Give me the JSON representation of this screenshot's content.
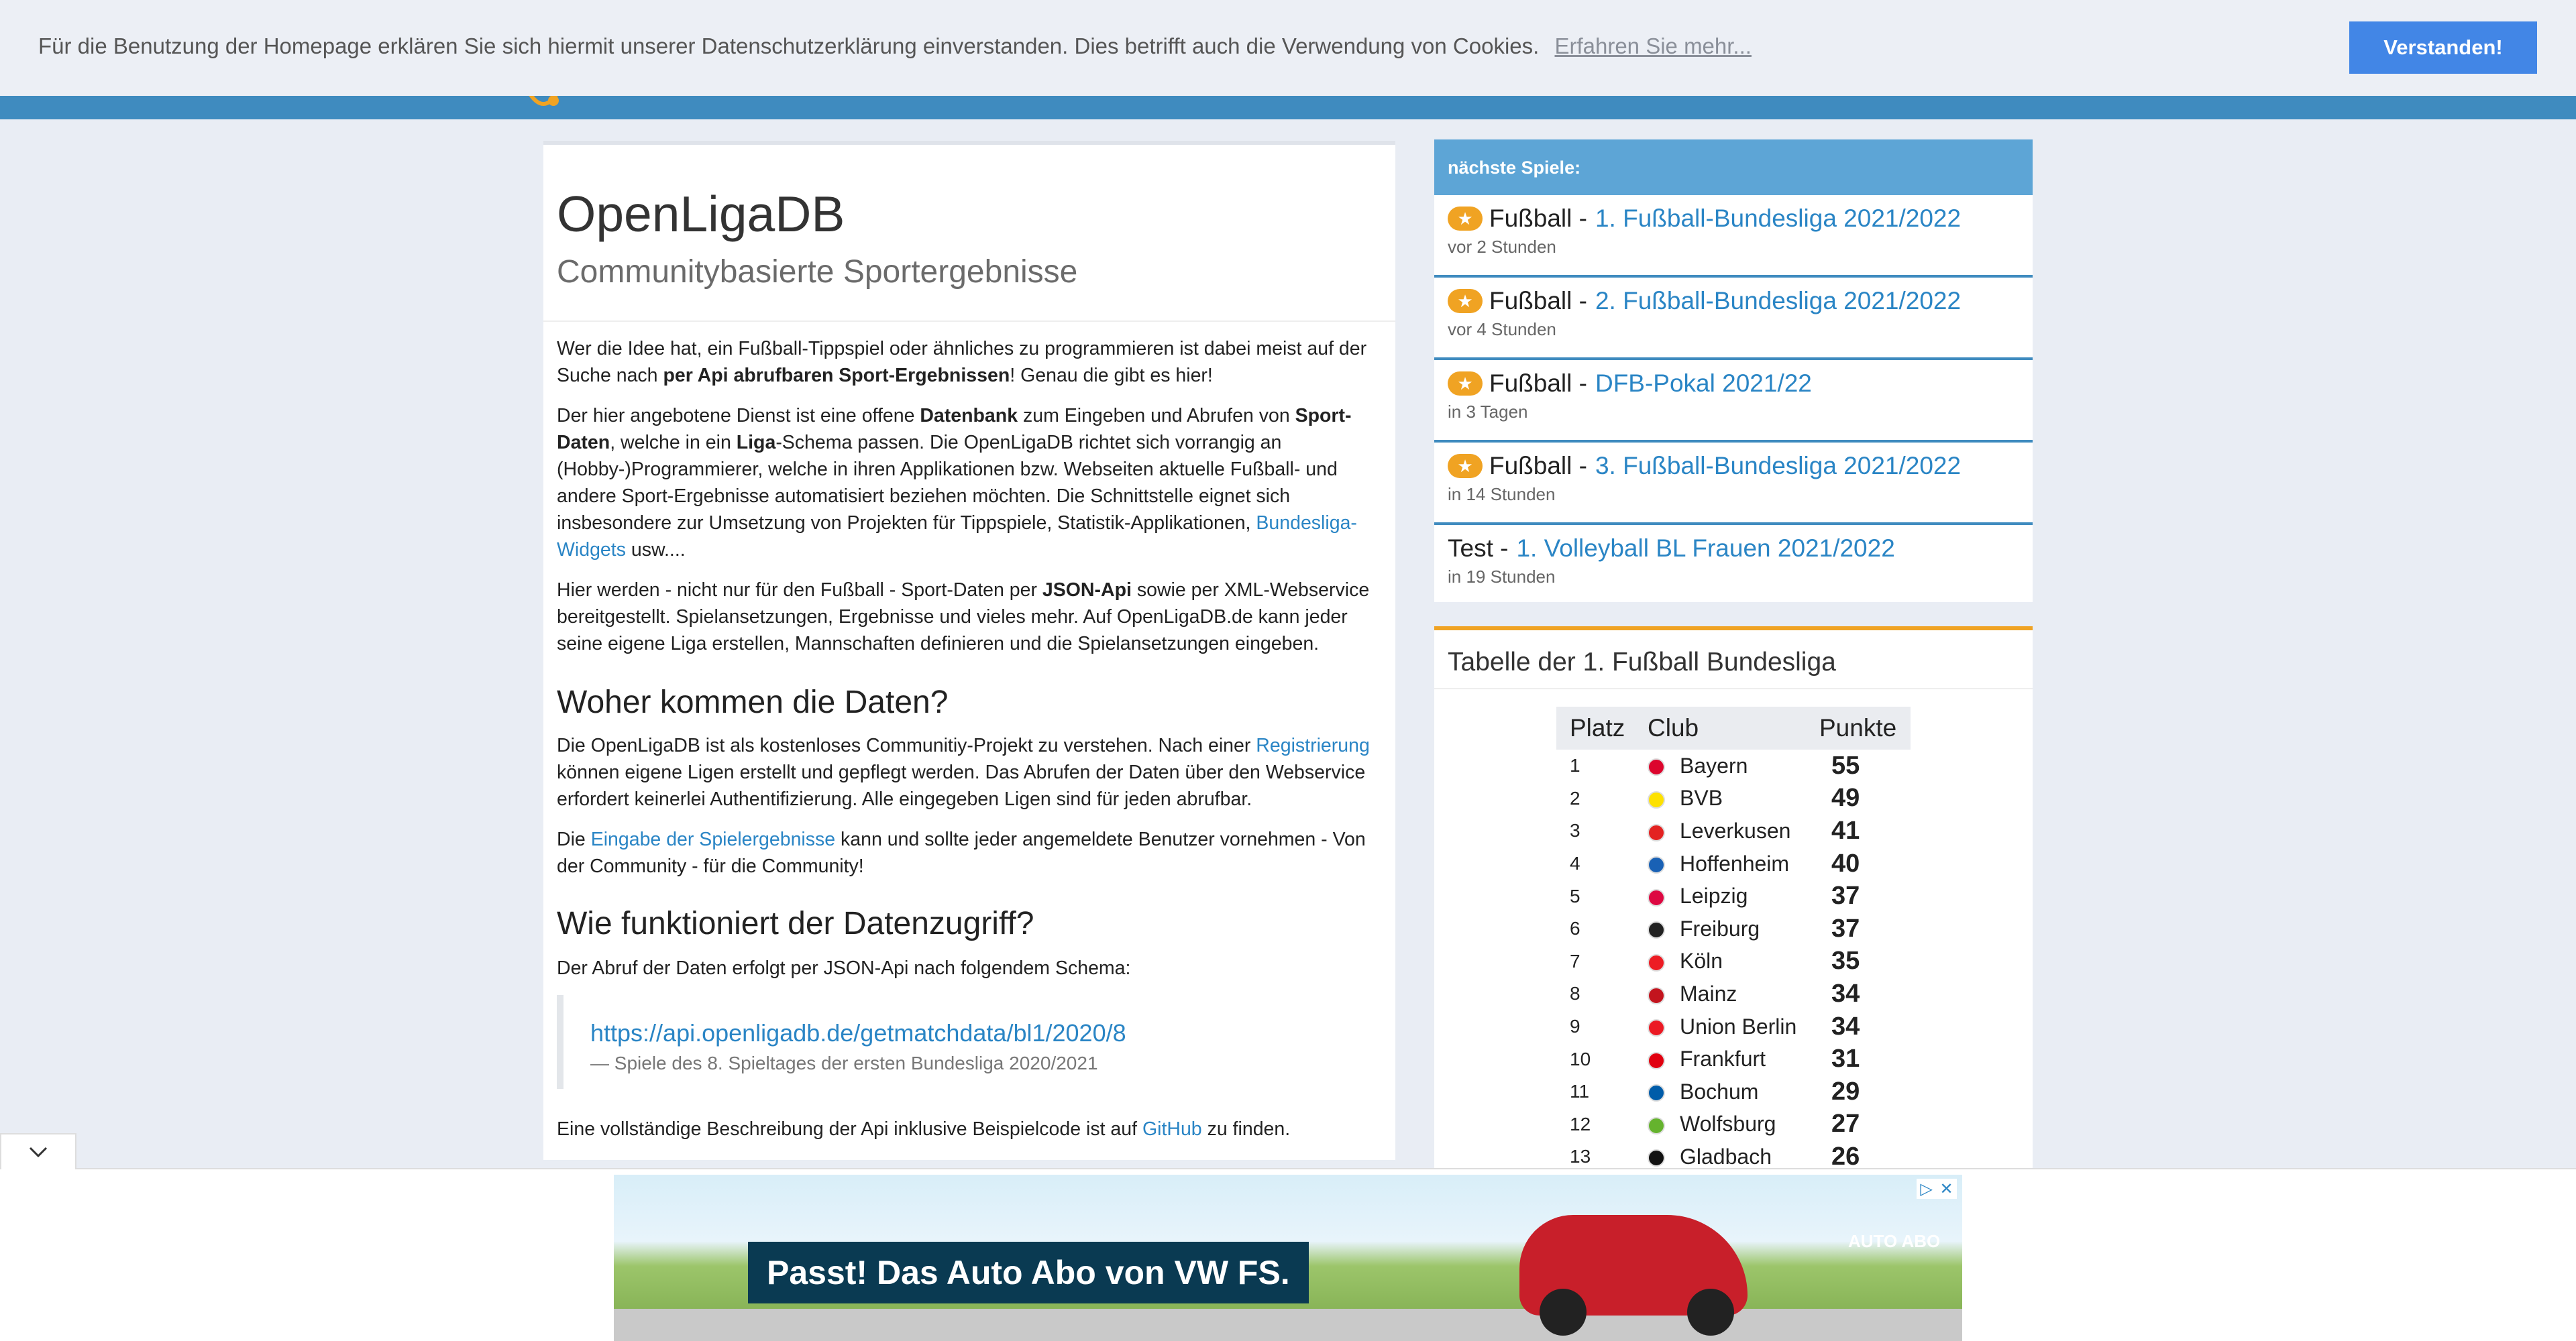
{
  "cookie": {
    "text": "Für die Benutzung der Homepage erklären Sie sich hiermit unserer Datenschutzerklärung einverstanden. Dies betrifft auch die Verwendung von Cookies.",
    "link": "Erfahren Sie mehr...",
    "button": "Verstanden!"
  },
  "main": {
    "title": "OpenLigaDB",
    "subtitle": "Communitybasierte Sportergebnisse",
    "p1_a": "Wer die Idee hat, ein Fußball-Tippspiel oder ähnliches zu programmieren ist dabei meist auf der Suche nach ",
    "p1_b": "per Api abrufbaren Sport-Ergebnissen",
    "p1_c": "! Genau die gibt es hier!",
    "p2_a": "Der hier angebotene Dienst ist eine offene ",
    "p2_b": "Datenbank",
    "p2_c": " zum Eingeben und Abrufen von ",
    "p2_d": "Sport-Daten",
    "p2_e": ", welche in ein ",
    "p2_f": "Liga",
    "p2_g": "-Schema passen. Die OpenLigaDB richtet sich vorrangig an (Hobby-)Programmierer, welche in ihren Applikationen bzw. Webseiten aktuelle Fußball- und andere Sport-Ergebnisse automatisiert beziehen möchten. Die Schnittstelle eignet sich insbesondere zur Umsetzung von Projekten für Tippspiele, Statistik-Applikationen, ",
    "p2_link": "Bundesliga-Widgets",
    "p2_h": " usw....",
    "p3_a": "Hier werden - nicht nur für den Fußball - Sport-Daten per ",
    "p3_b": "JSON-Api",
    "p3_c": " sowie per XML-Webservice bereitgestellt. Spielansetzungen, Ergebnisse und vieles mehr. Auf OpenLigaDB.de kann jeder seine eigene Liga erstellen, Mannschaften definieren und die Spielansetzungen eingeben.",
    "h2_1": "Woher kommen die Daten?",
    "p4_a": "Die OpenLigaDB ist als kostenloses Communitiy-Projekt zu verstehen. Nach einer ",
    "p4_link": "Registrierung",
    "p4_b": " können eigene Ligen erstellt und gepflegt werden. Das Abrufen der Daten über den Webservice erfordert keinerlei Authentifizierung. Alle eingegeben Ligen sind für jeden abrufbar.",
    "p5_a": "Die ",
    "p5_link": "Eingabe der Spielergebnisse",
    "p5_b": " kann und sollte jeder angemeldete Benutzer vornehmen - Von der Community - für die Community!",
    "h2_2": "Wie funktioniert der Datenzugriff?",
    "p6": "Der Abruf der Daten erfolgt per JSON-Api nach folgendem Schema:",
    "quote_link": "https://api.openligadb.de/getmatchdata/bl1/2020/8",
    "quote_foot": "— Spiele des 8. Spieltages der ersten Bundesliga 2020/2021",
    "p7_a": "Eine vollständige Beschreibung der Api inklusive Beispielcode ist auf ",
    "p7_link": "GitHub",
    "p7_b": " zu finden."
  },
  "games": {
    "header": "nächste Spiele:",
    "items": [
      {
        "sport": "Fußball -",
        "league": "1. Fußball-Bundesliga 2021/2022",
        "time": "vor 2 Stunden",
        "star": true
      },
      {
        "sport": "Fußball -",
        "league": "2. Fußball-Bundesliga 2021/2022",
        "time": "vor 4 Stunden",
        "star": true
      },
      {
        "sport": "Fußball -",
        "league": "DFB-Pokal 2021/22",
        "time": "in 3 Tagen",
        "star": true
      },
      {
        "sport": "Fußball -",
        "league": "3. Fußball-Bundesliga 2021/2022",
        "time": "in 14 Stunden",
        "star": true
      },
      {
        "sport": "Test -",
        "league": "1. Volleyball BL Frauen 2021/2022",
        "time": "in 19 Stunden",
        "star": false
      }
    ]
  },
  "table": {
    "title": "Tabelle der 1. Fußball Bundesliga",
    "headers": [
      "Platz",
      "Club",
      "Punkte"
    ],
    "rows": [
      {
        "rank": "1",
        "club": "Bayern",
        "points": "55",
        "color": "#dc052d"
      },
      {
        "rank": "2",
        "club": "BVB",
        "points": "49",
        "color": "#fde100"
      },
      {
        "rank": "3",
        "club": "Leverkusen",
        "points": "41",
        "color": "#e32221"
      },
      {
        "rank": "4",
        "club": "Hoffenheim",
        "points": "40",
        "color": "#1961b5"
      },
      {
        "rank": "5",
        "club": "Leipzig",
        "points": "37",
        "color": "#dd0741"
      },
      {
        "rank": "6",
        "club": "Freiburg",
        "points": "37",
        "color": "#222222"
      },
      {
        "rank": "7",
        "club": "Köln",
        "points": "35",
        "color": "#ed1c24"
      },
      {
        "rank": "8",
        "club": "Mainz",
        "points": "34",
        "color": "#c3141e"
      },
      {
        "rank": "9",
        "club": "Union Berlin",
        "points": "34",
        "color": "#eb1923"
      },
      {
        "rank": "10",
        "club": "Frankfurt",
        "points": "31",
        "color": "#e1000f"
      },
      {
        "rank": "11",
        "club": "Bochum",
        "points": "29",
        "color": "#005ca9"
      },
      {
        "rank": "12",
        "club": "Wolfsburg",
        "points": "27",
        "color": "#65b32e"
      },
      {
        "rank": "13",
        "club": "Gladbach",
        "points": "26",
        "color": "#111111"
      }
    ]
  },
  "ad": {
    "headline": "Passt! Das Auto Abo von VW FS.",
    "brand": "AUTO ABO",
    "toggle_icon": "chevron-down-icon",
    "info_icon": "adchoices-icon"
  }
}
